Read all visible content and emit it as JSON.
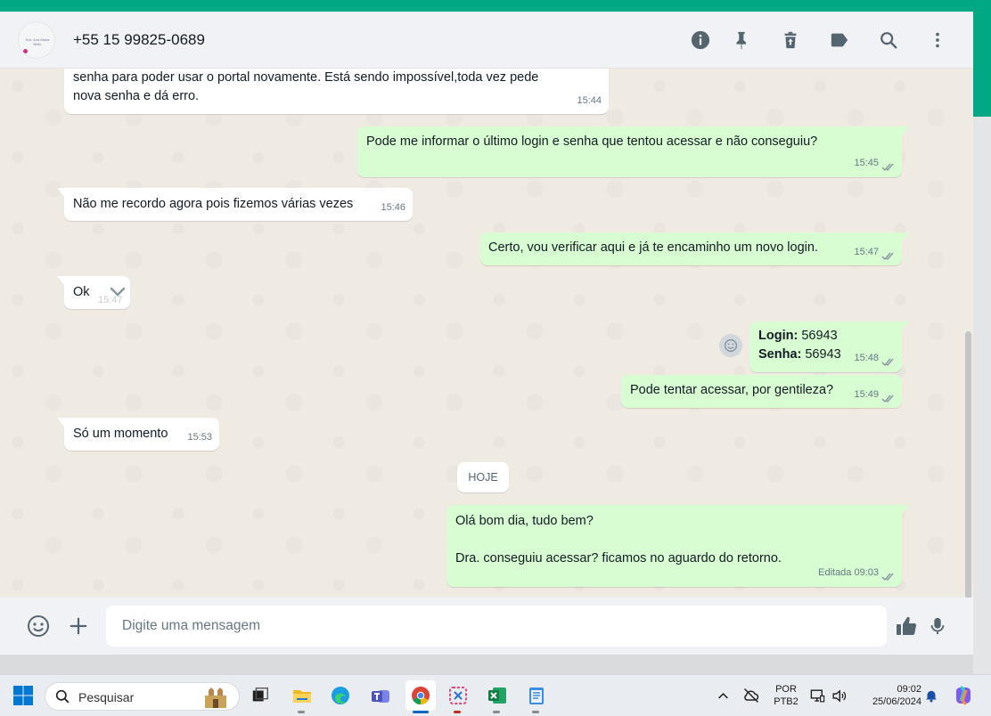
{
  "header": {
    "contact": "+55 15 99825-0689",
    "avatar_text": "Dra. Ana Maria Bello",
    "icons": [
      "info-icon",
      "pin-icon",
      "trash-icon",
      "label-icon",
      "search-icon",
      "menu-dots-icon"
    ]
  },
  "messages": [
    {
      "dir": "in",
      "lines": [
        "senha para poder usar o portal  novamente. Está sendo impossível,toda vez pede",
        "nova senha e dá  erro."
      ],
      "time": "15:44"
    },
    {
      "dir": "out",
      "text": "Pode me informar o último login e senha que tentou acessar e não conseguiu?",
      "time": "15:45"
    },
    {
      "dir": "in",
      "text": "Não  me recordo agora pois fizemos várias vezes",
      "time": "15:46"
    },
    {
      "dir": "out",
      "text": "Certo, vou verificar aqui e já te encaminho um novo login.",
      "time": "15:47"
    },
    {
      "dir": "in",
      "text": "Ok",
      "time": "15:47"
    },
    {
      "dir": "out",
      "login_label": "Login:",
      "login_value": " 56943",
      "senha_label": "Senha:",
      "senha_value": " 56943",
      "time": "15:48"
    },
    {
      "dir": "out",
      "text": "Pode tentar acessar, por gentileza?",
      "time": "15:49"
    },
    {
      "dir": "in",
      "text": "Só  um momento",
      "time": "15:53"
    },
    {
      "dir": "out",
      "line1": "Olá bom dia, tudo bem?",
      "line2": "Dra. conseguiu acessar? ficamos no aguardo do retorno.",
      "time": "Editada 09:03"
    }
  ],
  "date_divider": "HOJE",
  "composer": {
    "placeholder": "Digite uma mensagem"
  },
  "taskbar": {
    "search_label": "Pesquisar",
    "lang_top": "POR",
    "lang_bottom": "PTB2",
    "clock_time": "09:02",
    "clock_date": "25/06/2024"
  },
  "colors": {
    "accent": "#00a884",
    "outgoing": "#d9fdd3",
    "incoming": "#ffffff",
    "ticks": "#8696a0"
  }
}
